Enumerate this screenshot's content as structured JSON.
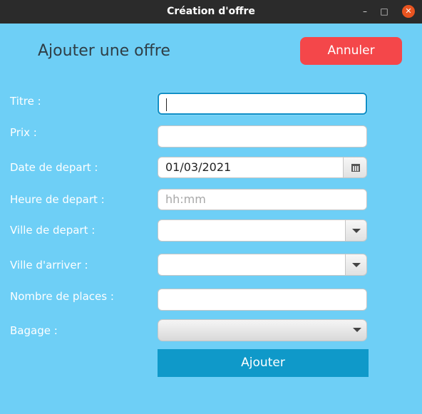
{
  "window": {
    "title": "Création d'offre",
    "minimize_glyph": "–",
    "maximize_glyph": "□",
    "close_glyph": "✕"
  },
  "header": {
    "heading": "Ajouter une offre",
    "cancel_label": "Annuler"
  },
  "form": {
    "titre_label": "Titre :",
    "titre_value": "",
    "prix_label": "Prix :",
    "prix_value": "",
    "date_label": "Date de depart :",
    "date_value": "01/03/2021",
    "heure_label": "Heure de depart :",
    "heure_placeholder": "hh:mm",
    "ville_depart_label": "Ville de depart :",
    "ville_depart_value": "",
    "ville_arriver_label": "Ville d'arriver :",
    "ville_arriver_value": "",
    "places_label": "Nombre de places :",
    "places_value": "",
    "bagage_label": "Bagage :",
    "bagage_value": "",
    "submit_label": "Ajouter"
  },
  "colors": {
    "background": "#6ecff6",
    "cancel": "#f4474a",
    "submit": "#0f99c9",
    "titlebar": "#2b2b2b",
    "close": "#e95420"
  }
}
